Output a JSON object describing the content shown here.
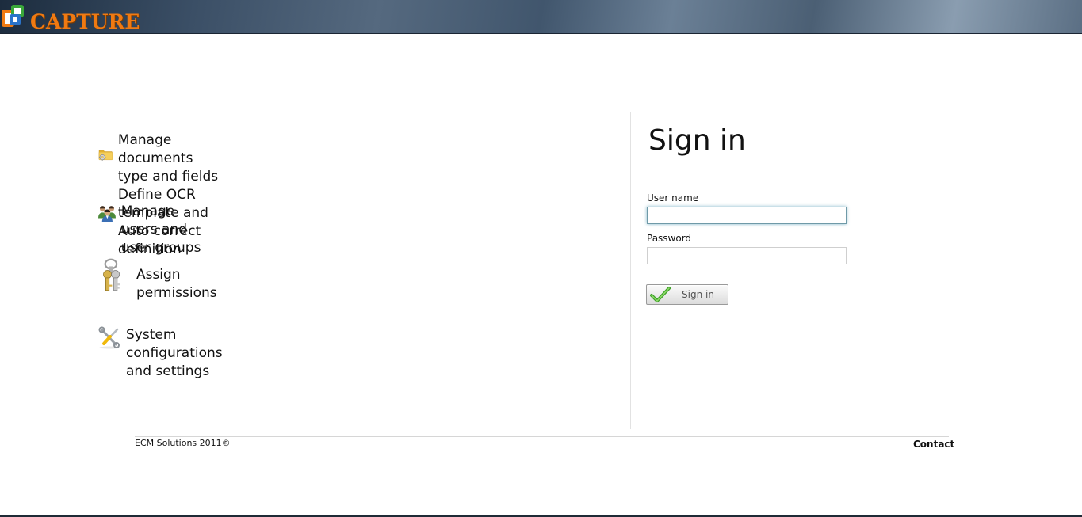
{
  "header": {
    "logo_text": "CAPTURE",
    "logo_colors": {
      "orange": "#f07a12",
      "blue": "#2a73c9",
      "green": "#3aa83a"
    }
  },
  "menu": {
    "items": [
      {
        "lines": [
          "Manage documents type and fields",
          "Define OCR template and Auto correct definition"
        ],
        "icon": "folder-gear-icon"
      },
      {
        "lines": [
          "Manage users and user groups"
        ],
        "icon": "users-icon"
      },
      {
        "lines": [
          "Assign permissions"
        ],
        "icon": "keys-icon"
      },
      {
        "lines": [
          "System configurations and settings"
        ],
        "icon": "tools-icon"
      }
    ]
  },
  "signin": {
    "title": "Sign in",
    "username_label": "User name",
    "username_value": "",
    "password_label": "Password",
    "password_value": "",
    "button_label": "Sign in",
    "button_icon": "checkmark-icon"
  },
  "footer": {
    "copyright": "ECM Solutions 2011®",
    "contact": "Contact"
  }
}
